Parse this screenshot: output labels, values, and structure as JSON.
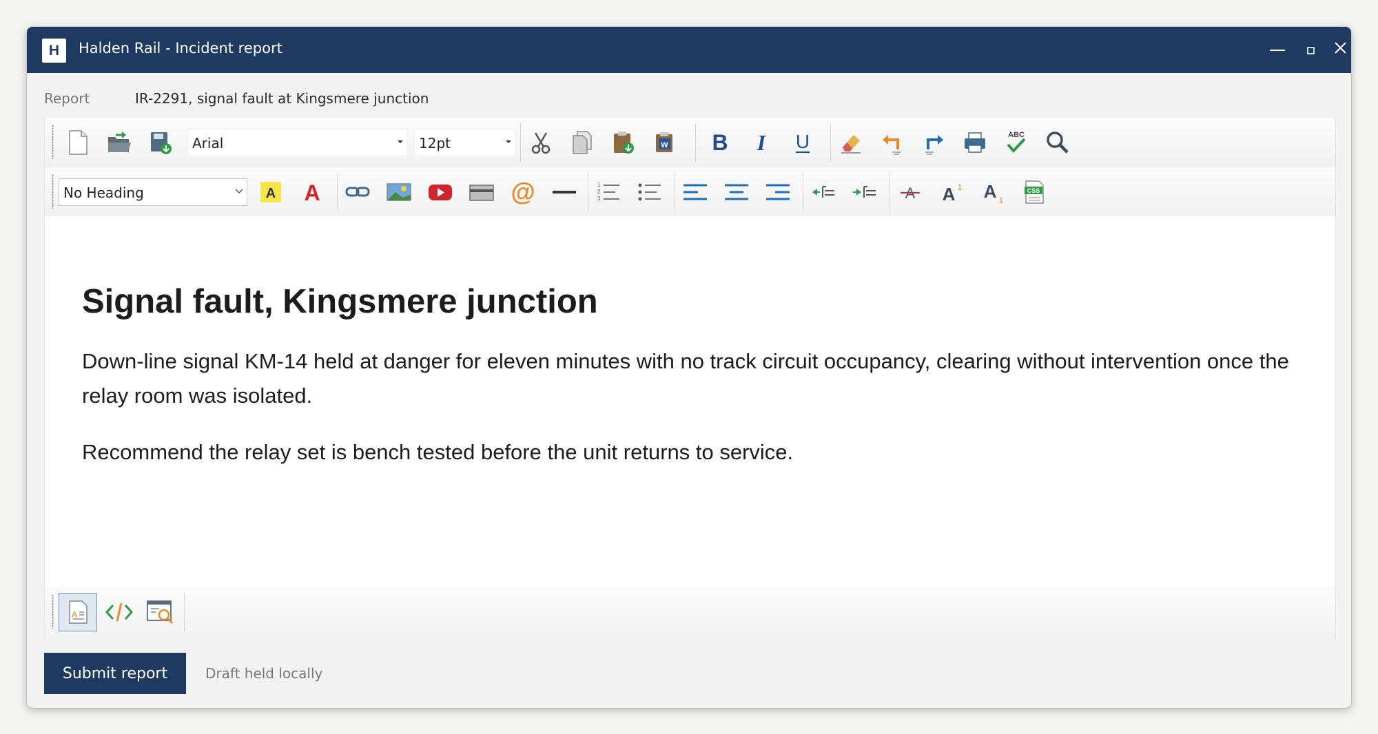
{
  "window": {
    "logo_letter": "H",
    "title": "Halden Rail - Incident report"
  },
  "report": {
    "label": "Report",
    "value": "IR-2291, signal fault at Kingsmere junction"
  },
  "toolbar": {
    "font_name": "Arial",
    "font_size": "12pt",
    "heading_style": "No Heading",
    "spellcheck_label": "ABC",
    "css_label": "CSS",
    "word_label": "W"
  },
  "document": {
    "heading": "Signal fault, Kingsmere junction",
    "paragraphs": [
      "Down-line signal KM-14 held at danger for eleven minutes with no track circuit occupancy, clearing without intervention once the relay room was isolated.",
      "Recommend the relay set is bench tested before the unit returns to service."
    ]
  },
  "footer": {
    "submit_label": "Submit report",
    "status": "Draft held locally"
  },
  "colors": {
    "titlebar": "#1f3a60",
    "accent_orange": "#e8892b",
    "accent_blue": "#1e6fb8",
    "accent_red": "#d0262b",
    "accent_green": "#2e9b47"
  }
}
